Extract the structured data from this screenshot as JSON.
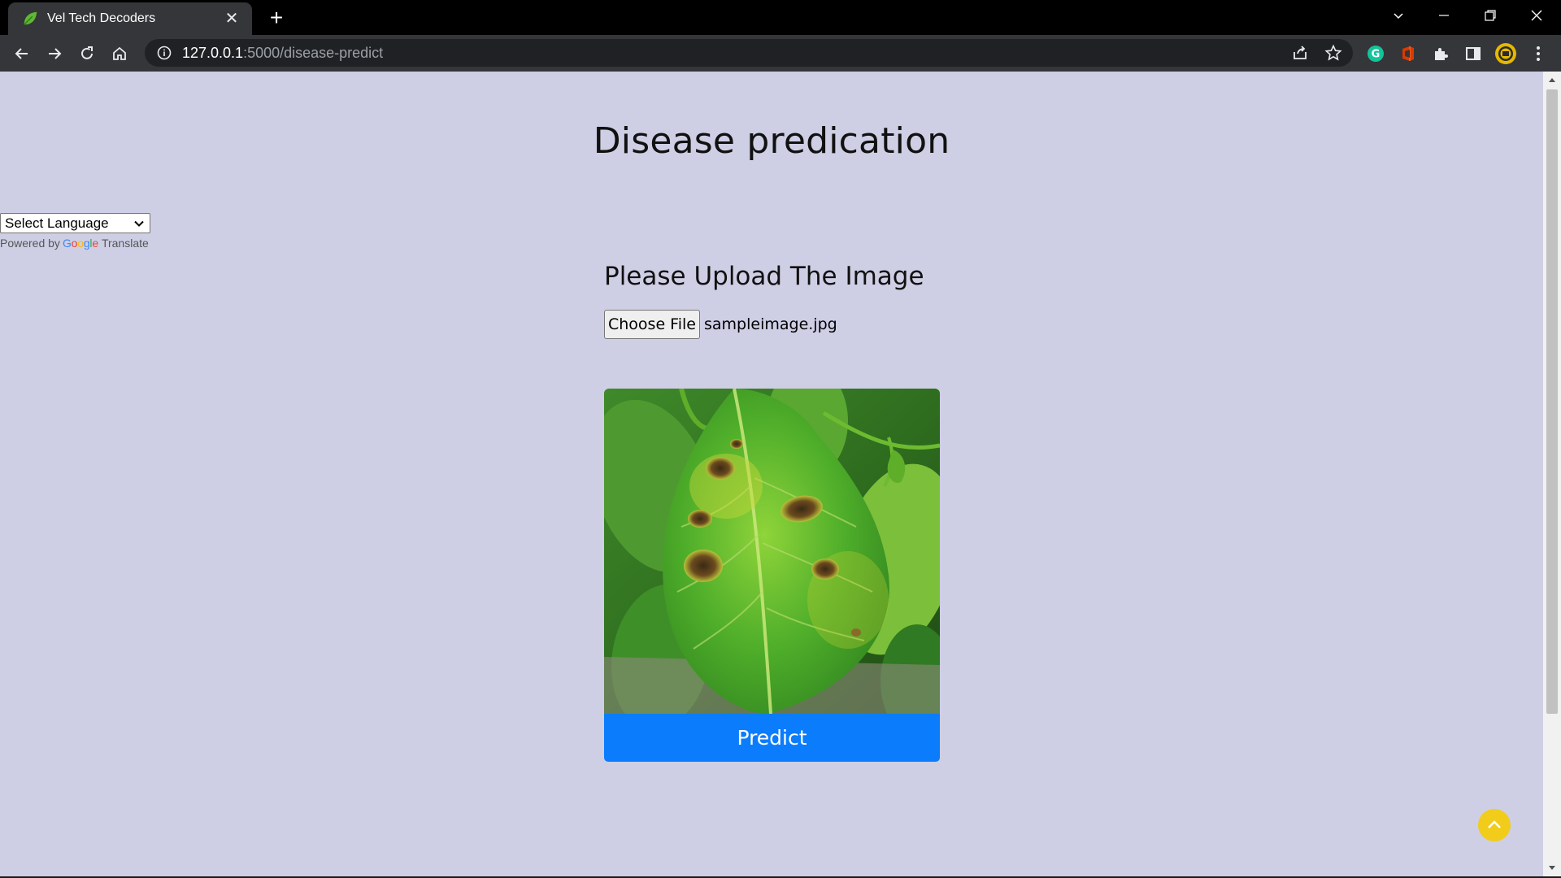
{
  "browser": {
    "tab": {
      "title": "Vel Tech Decoders"
    },
    "address": {
      "host": "127.0.0.1",
      "path": ":5000/disease-predict"
    }
  },
  "page": {
    "title": "Disease predication",
    "language_select": {
      "selected": "Select Language"
    },
    "powered_by": {
      "prefix": "Powered by",
      "brand": "Google",
      "link": "Translate"
    },
    "upload": {
      "heading": "Please Upload The Image",
      "choose_button": "Choose File",
      "filename": "sampleimage.jpg"
    },
    "predict_button": "Predict"
  },
  "icons": {
    "favicon": "leaf-icon",
    "back_to_top": "chevron-up-icon"
  },
  "colors": {
    "page_background": "#cecfe5",
    "predict_button": "#0b7dfc",
    "back_to_top": "#f1cc1b"
  }
}
